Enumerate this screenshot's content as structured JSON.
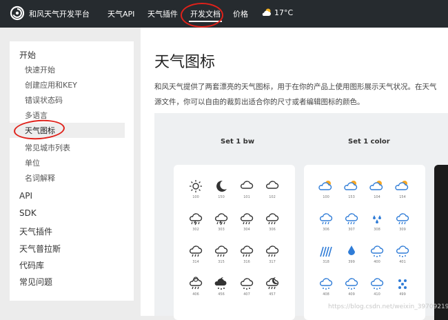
{
  "header": {
    "brand": "和风天气开发平台",
    "nav": [
      "天气API",
      "天气插件",
      "开发文档",
      "价格"
    ],
    "active_nav": "开发文档",
    "temperature": "17°C"
  },
  "sidebar": {
    "groups": [
      {
        "label": "开始",
        "items": [
          "快速开始",
          "创建应用和KEY",
          "错误状态码",
          "多语言",
          "天气图标",
          "常见城市列表",
          "单位",
          "名词解释"
        ]
      },
      {
        "label": "API"
      },
      {
        "label": "SDK"
      },
      {
        "label": "天气插件"
      },
      {
        "label": "天气普拉斯"
      },
      {
        "label": "代码库"
      },
      {
        "label": "常见问题"
      }
    ],
    "active_item": "天气图标"
  },
  "main": {
    "title": "天气图标",
    "desc_line1": "和风天气提供了两套漂亮的天气图标，用于在你的产品上使用图形展示天气状况。在天气",
    "desc_line2": "源文件，你可以自由的裁剪出适合你的尺寸或者编辑图标的颜色。",
    "set1_title": "Set 1 bw",
    "set2_title": "Set 1 color",
    "bw_icons": [
      {
        "code": "100",
        "icon": "sun-icon"
      },
      {
        "code": "150",
        "icon": "moon-icon"
      },
      {
        "code": "101",
        "icon": "cloud-icon"
      },
      {
        "code": "102",
        "icon": "cloud-icon"
      },
      {
        "code": "302",
        "icon": "thunder-rain-icon"
      },
      {
        "code": "303",
        "icon": "thunder-rain-icon"
      },
      {
        "code": "304",
        "icon": "rain-icon"
      },
      {
        "code": "306",
        "icon": "rain-icon"
      },
      {
        "code": "314",
        "icon": "rain-icon"
      },
      {
        "code": "315",
        "icon": "rain-icon"
      },
      {
        "code": "316",
        "icon": "rain-icon"
      },
      {
        "code": "317",
        "icon": "rain-icon"
      },
      {
        "code": "406",
        "icon": "sun-cloud-rain-icon"
      },
      {
        "code": "456",
        "icon": "moon-cloud-rain-icon"
      },
      {
        "code": "407",
        "icon": "snow-icon"
      },
      {
        "code": "457",
        "icon": "moon-cloud-icon"
      }
    ],
    "color_icons": [
      {
        "code": "100",
        "icon": "sun-cloud-icon"
      },
      {
        "code": "153",
        "icon": "sun-cloud-icon"
      },
      {
        "code": "104",
        "icon": "sun-cloud-icon"
      },
      {
        "code": "154",
        "icon": "sun-cloud-icon"
      },
      {
        "code": "306",
        "icon": "rain-icon"
      },
      {
        "code": "307",
        "icon": "rain-icon"
      },
      {
        "code": "308",
        "icon": "drops-icon"
      },
      {
        "code": "309",
        "icon": "rain-icon"
      },
      {
        "code": "318",
        "icon": "heavy-rain-icon"
      },
      {
        "code": "399",
        "icon": "drop-icon"
      },
      {
        "code": "400",
        "icon": "cloud-snow-icon"
      },
      {
        "code": "401",
        "icon": "cloud-snow-icon"
      },
      {
        "code": "408",
        "icon": "cloud-snow-icon"
      },
      {
        "code": "409",
        "icon": "cloud-snow-icon"
      },
      {
        "code": "410",
        "icon": "cloud-snow-icon"
      },
      {
        "code": "499",
        "icon": "snowflake-icon"
      }
    ]
  },
  "watermark": "https://blog.csdn.net/weixin_39709219",
  "colors": {
    "topbar": "#262b2f",
    "annotation": "#e0211a",
    "icon_blue": "#2f7cd7",
    "icon_orange": "#f5a623"
  }
}
